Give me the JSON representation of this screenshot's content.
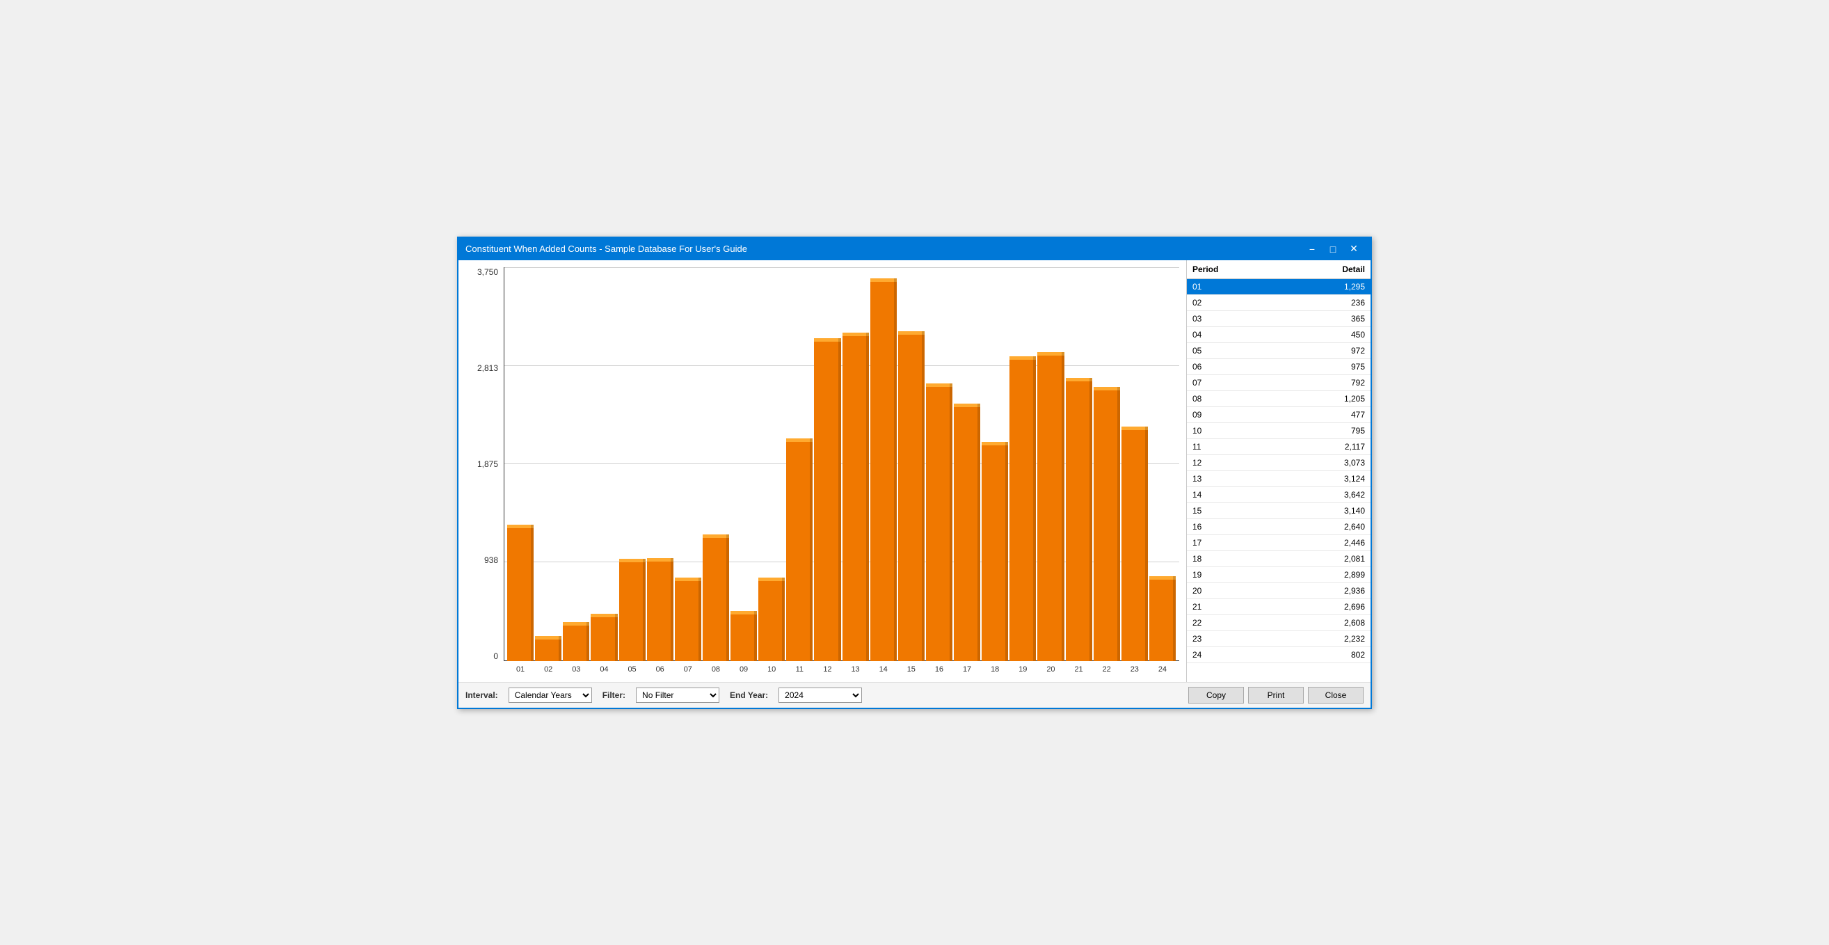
{
  "window": {
    "title": "Constituent When Added Counts - Sample Database For User's Guide",
    "minimize_label": "−",
    "maximize_label": "□",
    "close_label": "✕"
  },
  "chart": {
    "y_axis_labels": [
      "3,750",
      "2,813",
      "1,875",
      "938",
      "0"
    ],
    "max_value": 3750,
    "bars": [
      {
        "period": "01",
        "value": 1295
      },
      {
        "period": "02",
        "value": 236
      },
      {
        "period": "03",
        "value": 365
      },
      {
        "period": "04",
        "value": 450
      },
      {
        "period": "05",
        "value": 972
      },
      {
        "period": "06",
        "value": 975
      },
      {
        "period": "07",
        "value": 792
      },
      {
        "period": "08",
        "value": 1205
      },
      {
        "period": "09",
        "value": 477
      },
      {
        "period": "10",
        "value": 795
      },
      {
        "period": "11",
        "value": 2117
      },
      {
        "period": "12",
        "value": 3073
      },
      {
        "period": "13",
        "value": 3124
      },
      {
        "period": "14",
        "value": 3642
      },
      {
        "period": "15",
        "value": 3140
      },
      {
        "period": "16",
        "value": 2640
      },
      {
        "period": "17",
        "value": 2446
      },
      {
        "period": "18",
        "value": 2081
      },
      {
        "period": "19",
        "value": 2899
      },
      {
        "period": "20",
        "value": 2936
      },
      {
        "period": "21",
        "value": 2696
      },
      {
        "period": "22",
        "value": 2608
      },
      {
        "period": "23",
        "value": 2232
      },
      {
        "period": "24",
        "value": 802
      }
    ]
  },
  "bottom_bar": {
    "interval_label": "Interval:",
    "interval_value": "Calendar Years",
    "filter_label": "Filter:",
    "filter_value": "No Filter",
    "end_year_label": "End Year:",
    "end_year_value": "2024",
    "copy_button": "Copy",
    "print_button": "Print",
    "close_button": "Close"
  },
  "panel": {
    "col_period": "Period",
    "col_detail": "Detail",
    "rows": [
      {
        "period": "01",
        "detail": "1,295",
        "selected": true
      },
      {
        "period": "02",
        "detail": "236"
      },
      {
        "period": "03",
        "detail": "365"
      },
      {
        "period": "04",
        "detail": "450"
      },
      {
        "period": "05",
        "detail": "972"
      },
      {
        "period": "06",
        "detail": "975"
      },
      {
        "period": "07",
        "detail": "792"
      },
      {
        "period": "08",
        "detail": "1,205"
      },
      {
        "period": "09",
        "detail": "477"
      },
      {
        "period": "10",
        "detail": "795"
      },
      {
        "period": "11",
        "detail": "2,117"
      },
      {
        "period": "12",
        "detail": "3,073"
      },
      {
        "period": "13",
        "detail": "3,124"
      },
      {
        "period": "14",
        "detail": "3,642"
      },
      {
        "period": "15",
        "detail": "3,140"
      },
      {
        "period": "16",
        "detail": "2,640"
      },
      {
        "period": "17",
        "detail": "2,446"
      },
      {
        "period": "18",
        "detail": "2,081"
      },
      {
        "period": "19",
        "detail": "2,899"
      },
      {
        "period": "20",
        "detail": "2,936"
      },
      {
        "period": "21",
        "detail": "2,696"
      },
      {
        "period": "22",
        "detail": "2,608"
      },
      {
        "period": "23",
        "detail": "2,232"
      },
      {
        "period": "24",
        "detail": "802"
      }
    ]
  }
}
